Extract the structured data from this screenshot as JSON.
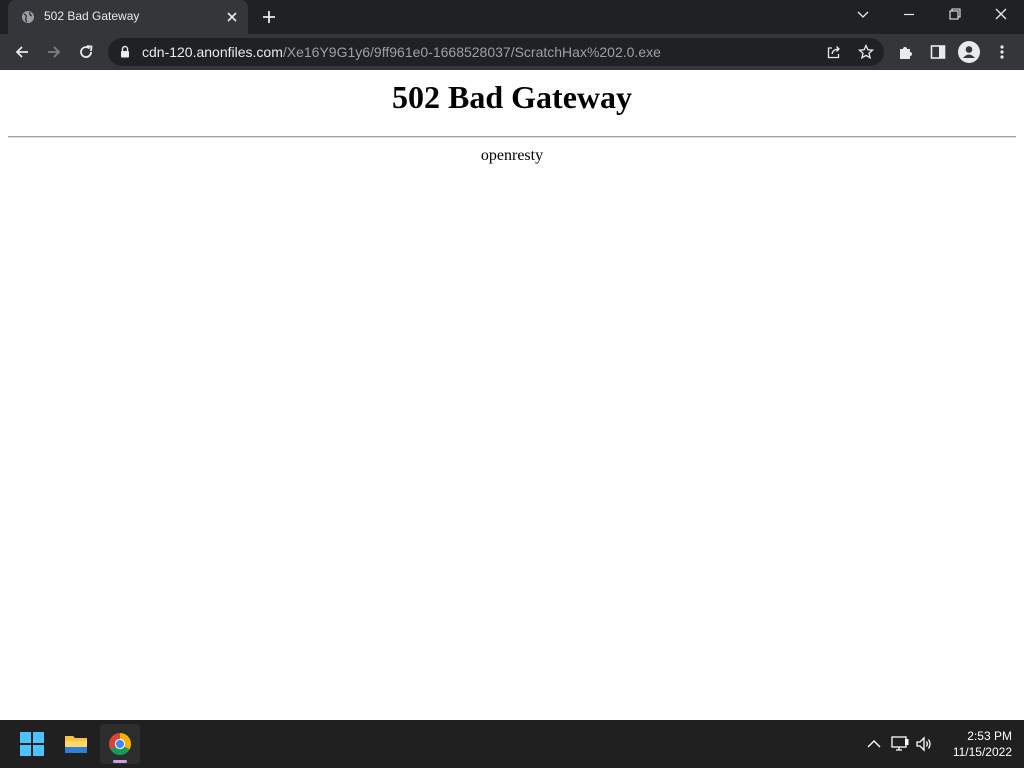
{
  "browser": {
    "tab": {
      "title": "502 Bad Gateway"
    },
    "address": {
      "host": "cdn-120.anonfiles.com",
      "path": "/Xe16Y9G1y6/9ff961e0-1668528037/ScratchHax%202.0.exe"
    },
    "icons": {
      "favicon": "globe-icon",
      "back": "arrow-left-icon",
      "forward": "arrow-right-icon",
      "reload": "reload-icon",
      "lock": "lock-icon",
      "share": "share-icon",
      "bookmark": "star-icon",
      "extensions": "puzzle-icon",
      "side_panel": "side-panel-icon",
      "profile": "profile-icon",
      "menu": "kebab-menu-icon"
    }
  },
  "page": {
    "heading": "502 Bad Gateway",
    "server": "openresty"
  },
  "taskbar": {
    "apps": [
      "windows-start-icon",
      "file-explorer-icon",
      "chrome-icon"
    ],
    "time": "2:53 PM",
    "date": "11/15/2022"
  },
  "colors": {
    "chrome_dark": "#202124",
    "toolbar": "#35363a",
    "taskbar": "#202020",
    "page_bg": "#ffffff"
  }
}
